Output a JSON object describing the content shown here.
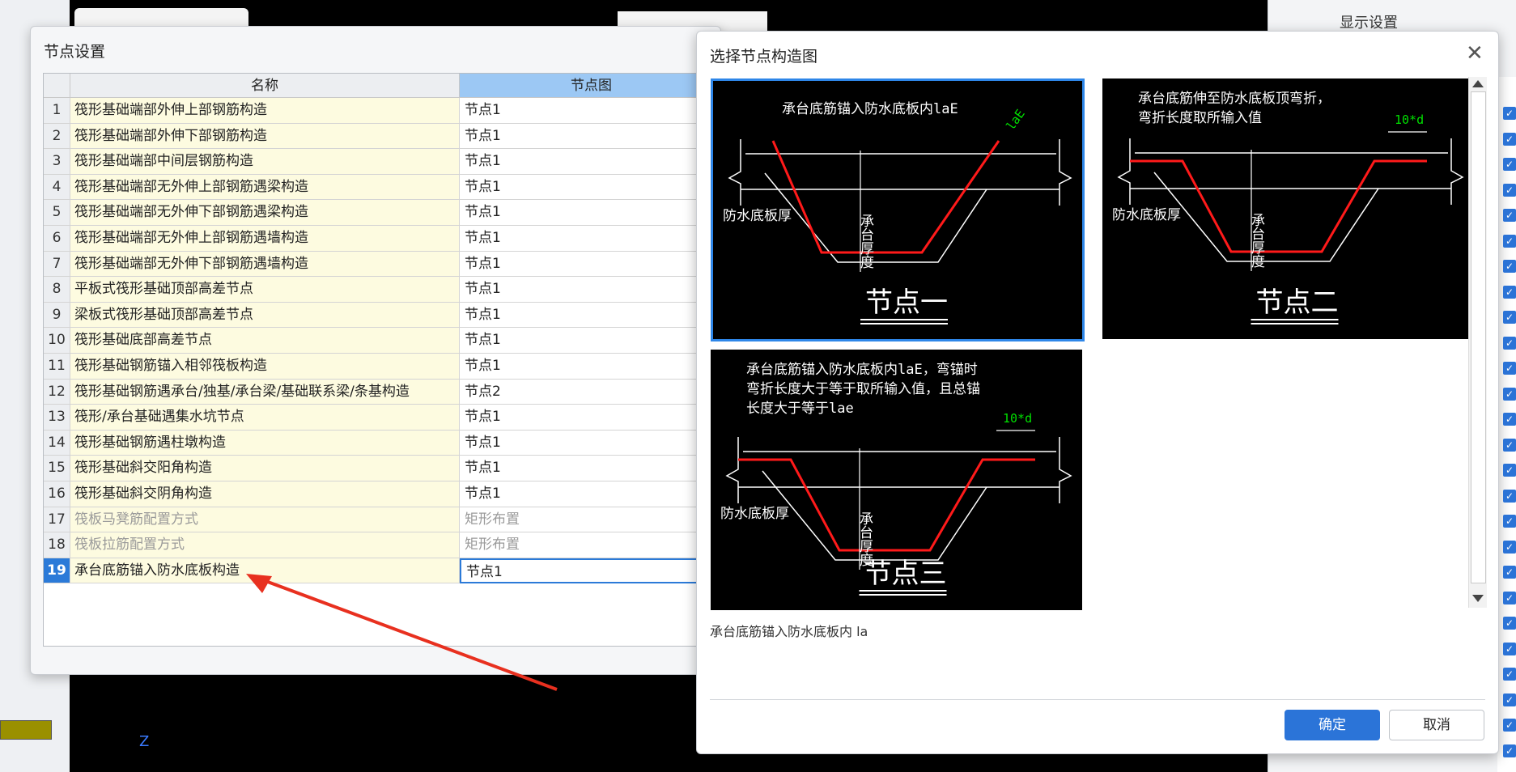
{
  "background": {
    "right_panel_title": "显示设置",
    "axis_label": "Z"
  },
  "node_settings_dialog": {
    "title": "节点设置",
    "columns": [
      "名称",
      "节点图"
    ],
    "rows": [
      {
        "num": "1",
        "name": "筏形基础端部外伸上部钢筋构造",
        "node": "节点1"
      },
      {
        "num": "2",
        "name": "筏形基础端部外伸下部钢筋构造",
        "node": "节点1"
      },
      {
        "num": "3",
        "name": "筏形基础端部中间层钢筋构造",
        "node": "节点1"
      },
      {
        "num": "4",
        "name": "筏形基础端部无外伸上部钢筋遇梁构造",
        "node": "节点1"
      },
      {
        "num": "5",
        "name": "筏形基础端部无外伸下部钢筋遇梁构造",
        "node": "节点1"
      },
      {
        "num": "6",
        "name": "筏形基础端部无外伸上部钢筋遇墙构造",
        "node": "节点1"
      },
      {
        "num": "7",
        "name": "筏形基础端部无外伸下部钢筋遇墙构造",
        "node": "节点1"
      },
      {
        "num": "8",
        "name": "平板式筏形基础顶部高差节点",
        "node": "节点1"
      },
      {
        "num": "9",
        "name": "梁板式筏形基础顶部高差节点",
        "node": "节点1"
      },
      {
        "num": "10",
        "name": "筏形基础底部高差节点",
        "node": "节点1"
      },
      {
        "num": "11",
        "name": "筏形基础钢筋锚入相邻筏板构造",
        "node": "节点1"
      },
      {
        "num": "12",
        "name": "筏形基础钢筋遇承台/独基/承台梁/基础联系梁/条基构造",
        "node": "节点2"
      },
      {
        "num": "13",
        "name": "筏形/承台基础遇集水坑节点",
        "node": "节点1"
      },
      {
        "num": "14",
        "name": "筏形基础钢筋遇柱墩构造",
        "node": "节点1"
      },
      {
        "num": "15",
        "name": "筏形基础斜交阳角构造",
        "node": "节点1"
      },
      {
        "num": "16",
        "name": "筏形基础斜交阴角构造",
        "node": "节点1"
      },
      {
        "num": "17",
        "name": "筏板马凳筋配置方式",
        "node": "矩形布置"
      },
      {
        "num": "18",
        "name": "筏板拉筋配置方式",
        "node": "矩形布置"
      },
      {
        "num": "19",
        "name": "承台底筋锚入防水底板构造",
        "node": "节点1"
      }
    ],
    "selected_row": "19",
    "ellipsis_button": "⋯"
  },
  "node_picker_dialog": {
    "title": "选择节点构造图",
    "close_icon": "close-icon",
    "options": [
      {
        "caption": "节点一",
        "text_lines": [
          "承台底筋锚入防水底板内laE"
        ],
        "dim_label": "laE",
        "side_label": "防水底板厚",
        "vertical_label": "承台厚度"
      },
      {
        "caption": "节点二",
        "text_lines": [
          "承台底筋伸至防水底板顶弯折，",
          "弯折长度取所输入值"
        ],
        "dim_label": "10*d",
        "side_label": "防水底板厚",
        "vertical_label": "承台厚度"
      },
      {
        "caption": "节点三",
        "text_lines": [
          "承台底筋锚入防水底板内laE，弯锚时",
          "弯折长度大于等于取所输入值，且总锚",
          "长度大于等于lae"
        ],
        "dim_label": "10*d",
        "side_label": "防水底板厚",
        "vertical_label": "承台厚度"
      }
    ],
    "selected_option": "节点一",
    "description": "承台底筋锚入防水底板内 la",
    "ok_label": "确定",
    "cancel_label": "取消"
  },
  "colors": {
    "accent": "#2b74d8",
    "rebar_red": "#ff1a1a",
    "dimension_green": "#00e000",
    "name_cell_bg": "#fdfbe0",
    "annotation_arrow": "#e8301f"
  }
}
